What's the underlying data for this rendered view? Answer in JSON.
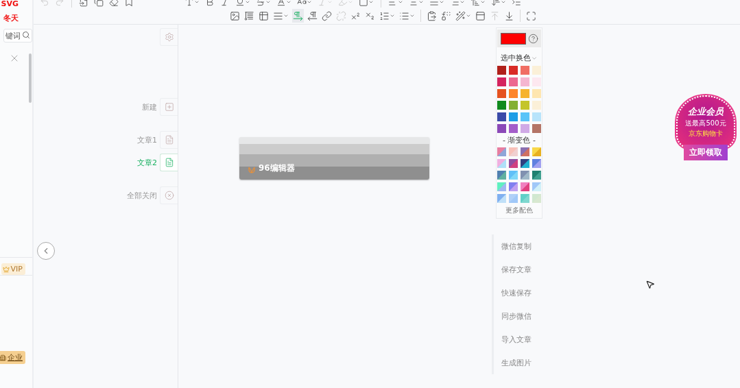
{
  "left_panel": {
    "brand_lines": [
      "SVG",
      "冬天"
    ],
    "search": {
      "placeholder": "键词"
    },
    "badges": [
      {
        "label": "VIP",
        "kind": "vip"
      },
      {
        "label": "企业",
        "kind": "enterprise"
      }
    ]
  },
  "toolbar": {
    "rows": [
      {
        "items": [
          {
            "disabled": true,
            "dropdown": false,
            "selected": false
          },
          {
            "disabled": true,
            "dropdown": false,
            "selected": false
          },
          {
            "kind": "separator"
          },
          {
            "disabled": false,
            "dropdown": false,
            "selected": false
          },
          {
            "disabled": false,
            "dropdown": false,
            "selected": false
          },
          {
            "disabled": false,
            "dropdown": false,
            "selected": false
          },
          {
            "disabled": false,
            "dropdown": false,
            "selected": false
          },
          {
            "kind": "gap"
          },
          {
            "disabled": false,
            "dropdown": true,
            "selected": false
          },
          {
            "disabled": false,
            "dropdown": false,
            "selected": false
          },
          {
            "disabled": false,
            "dropdown": false,
            "selected": false
          },
          {
            "disabled": false,
            "dropdown": true,
            "selected": false
          },
          {
            "disabled": false,
            "dropdown": true,
            "selected": false
          },
          {
            "disabled": false,
            "dropdown": true,
            "selected": false
          },
          {
            "disabled": false,
            "dropdown": true,
            "selected": false
          },
          {
            "disabled": true,
            "dropdown": true,
            "selected": false
          },
          {
            "disabled": true,
            "dropdown": true,
            "selected": false
          },
          {
            "disabled": false,
            "dropdown": true,
            "selected": false
          },
          {
            "kind": "separator"
          },
          {
            "disabled": false,
            "dropdown": true,
            "selected": false
          },
          {
            "disabled": false,
            "dropdown": true,
            "selected": false
          },
          {
            "disabled": false,
            "dropdown": true,
            "selected": false
          },
          {
            "disabled": false,
            "dropdown": true,
            "selected": false
          },
          {
            "disabled": false,
            "dropdown": true,
            "selected": false
          },
          {
            "disabled": false,
            "dropdown": true,
            "selected": false
          },
          {
            "disabled": false,
            "dropdown": false,
            "selected": false
          }
        ]
      },
      {
        "items": [
          {
            "disabled": false,
            "dropdown": false,
            "selected": false
          },
          {
            "disabled": false,
            "dropdown": false,
            "selected": false
          },
          {
            "disabled": false,
            "dropdown": false,
            "selected": false
          },
          {
            "disabled": false,
            "dropdown": true,
            "selected": false
          },
          {
            "disabled": false,
            "dropdown": false,
            "selected": true
          },
          {
            "disabled": false,
            "dropdown": false,
            "selected": false
          },
          {
            "disabled": false,
            "dropdown": false,
            "selected": false
          },
          {
            "disabled": true,
            "dropdown": false,
            "selected": false
          },
          {
            "disabled": false,
            "dropdown": false,
            "selected": false
          },
          {
            "disabled": false,
            "dropdown": false,
            "selected": false
          },
          {
            "disabled": false,
            "dropdown": true,
            "selected": false
          },
          {
            "disabled": false,
            "dropdown": true,
            "selected": false
          },
          {
            "kind": "separator"
          },
          {
            "disabled": false,
            "dropdown": false,
            "selected": false
          },
          {
            "disabled": false,
            "dropdown": false,
            "selected": false
          },
          {
            "disabled": false,
            "dropdown": true,
            "selected": false
          },
          {
            "disabled": false,
            "dropdown": false,
            "selected": false
          },
          {
            "disabled": true,
            "dropdown": false,
            "selected": false
          },
          {
            "disabled": false,
            "dropdown": false,
            "selected": false
          },
          {
            "kind": "separator"
          },
          {
            "disabled": false,
            "dropdown": false,
            "selected": false
          }
        ]
      }
    ]
  },
  "tabs_rail": {
    "items": [
      {
        "kind": "settings",
        "selected": false
      },
      {
        "kind": "new",
        "label": "新建",
        "selected": false
      },
      {
        "kind": "doc",
        "label": "文章1",
        "selected": false
      },
      {
        "kind": "doc",
        "label": "文章2",
        "selected": true
      },
      {
        "kind": "close_all",
        "label": "全部关闭",
        "selected": false
      }
    ]
  },
  "editor": {
    "banner": {
      "title": "96编辑器"
    }
  },
  "color_panel": {
    "current": {
      "color": "#ff0000"
    },
    "mode": "选中换色",
    "solid": [
      {
        "color": "#b0201a"
      },
      {
        "color": "#d92b26"
      },
      {
        "color": "#f06e64"
      },
      {
        "color": "#fbf0d8"
      },
      {
        "color": "#d4245e"
      },
      {
        "color": "#ec6891"
      },
      {
        "color": "#f5b6d0"
      },
      {
        "color": "#fde8f0"
      },
      {
        "color": "#e5521f"
      },
      {
        "color": "#fd852a"
      },
      {
        "color": "#f6b32e"
      },
      {
        "color": "#fee6b0"
      },
      {
        "color": "#108a1e"
      },
      {
        "color": "#83b033"
      },
      {
        "color": "#c4c52a"
      },
      {
        "color": "#fbf0d8"
      },
      {
        "color": "#3a4aa8"
      },
      {
        "color": "#1f9de6"
      },
      {
        "color": "#5ac4f8"
      },
      {
        "color": "#b8e4fb"
      },
      {
        "color": "#8b49b8"
      },
      {
        "color": "#a45dc9"
      },
      {
        "color": "#d0aae6"
      },
      {
        "color": "#b47566"
      }
    ],
    "gradient_title": "- 渐变色 -",
    "gradients": [
      {
        "stops": [
          {
            "color": "#e87ea0"
          },
          {
            "color": "#8fa6d8"
          }
        ]
      },
      {
        "stops": [
          {
            "color": "#f8c0b8"
          },
          {
            "color": "#f0d0d0"
          }
        ]
      },
      {
        "stops": [
          {
            "color": "#8a6fb0"
          },
          {
            "color": "#d07060"
          }
        ]
      },
      {
        "stops": [
          {
            "color": "#f8d848"
          },
          {
            "color": "#e8b020"
          }
        ]
      },
      {
        "stops": [
          {
            "color": "#f0b0e0"
          },
          {
            "color": "#b0e0f8"
          }
        ]
      },
      {
        "stops": [
          {
            "color": "#9050a0"
          },
          {
            "color": "#d04080"
          }
        ]
      },
      {
        "stops": [
          {
            "color": "#304080"
          },
          {
            "color": "#20b0d0"
          }
        ]
      },
      {
        "stops": [
          {
            "color": "#6080e0"
          },
          {
            "color": "#a0a0f0"
          }
        ]
      },
      {
        "stops": [
          {
            "color": "#5080b0"
          },
          {
            "color": "#60b0a0"
          }
        ]
      },
      {
        "stops": [
          {
            "color": "#60c0f8"
          },
          {
            "color": "#80d8f8"
          }
        ]
      },
      {
        "stops": [
          {
            "color": "#8090b0"
          },
          {
            "color": "#a0b8c8"
          }
        ]
      },
      {
        "stops": [
          {
            "color": "#208070"
          },
          {
            "color": "#40a090"
          }
        ]
      },
      {
        "stops": [
          {
            "color": "#60f0c0"
          },
          {
            "color": "#a0b8f0"
          }
        ]
      },
      {
        "stops": [
          {
            "color": "#8080f0"
          },
          {
            "color": "#c0a0f0"
          }
        ]
      },
      {
        "stops": [
          {
            "color": "#f080c0"
          },
          {
            "color": "#e04080"
          }
        ]
      },
      {
        "stops": [
          {
            "color": "#a0c8f8"
          },
          {
            "color": "#d0f0f8"
          }
        ]
      },
      {
        "stops": [
          {
            "color": "#80b0f0"
          },
          {
            "color": "#c0e0f8"
          }
        ]
      },
      {
        "stops": [
          {
            "color": "#b0d0f8"
          },
          {
            "color": "#a0c8f8"
          }
        ]
      },
      {
        "stops": [
          {
            "color": "#60d0c8"
          },
          {
            "color": "#80d8d0"
          }
        ]
      },
      {
        "stops": [
          {
            "color": "#d0e8d0"
          },
          {
            "color": "#d8e8d0"
          }
        ]
      }
    ],
    "more": "更多配色"
  },
  "actions": [
    "微信复制",
    "保存文章",
    "快速保存",
    "同步微信",
    "导入文章",
    "生成图片"
  ],
  "promo": {
    "title": "企业会员",
    "line1": "送最高500元",
    "line2": "京东购物卡",
    "button": "立即领取"
  }
}
